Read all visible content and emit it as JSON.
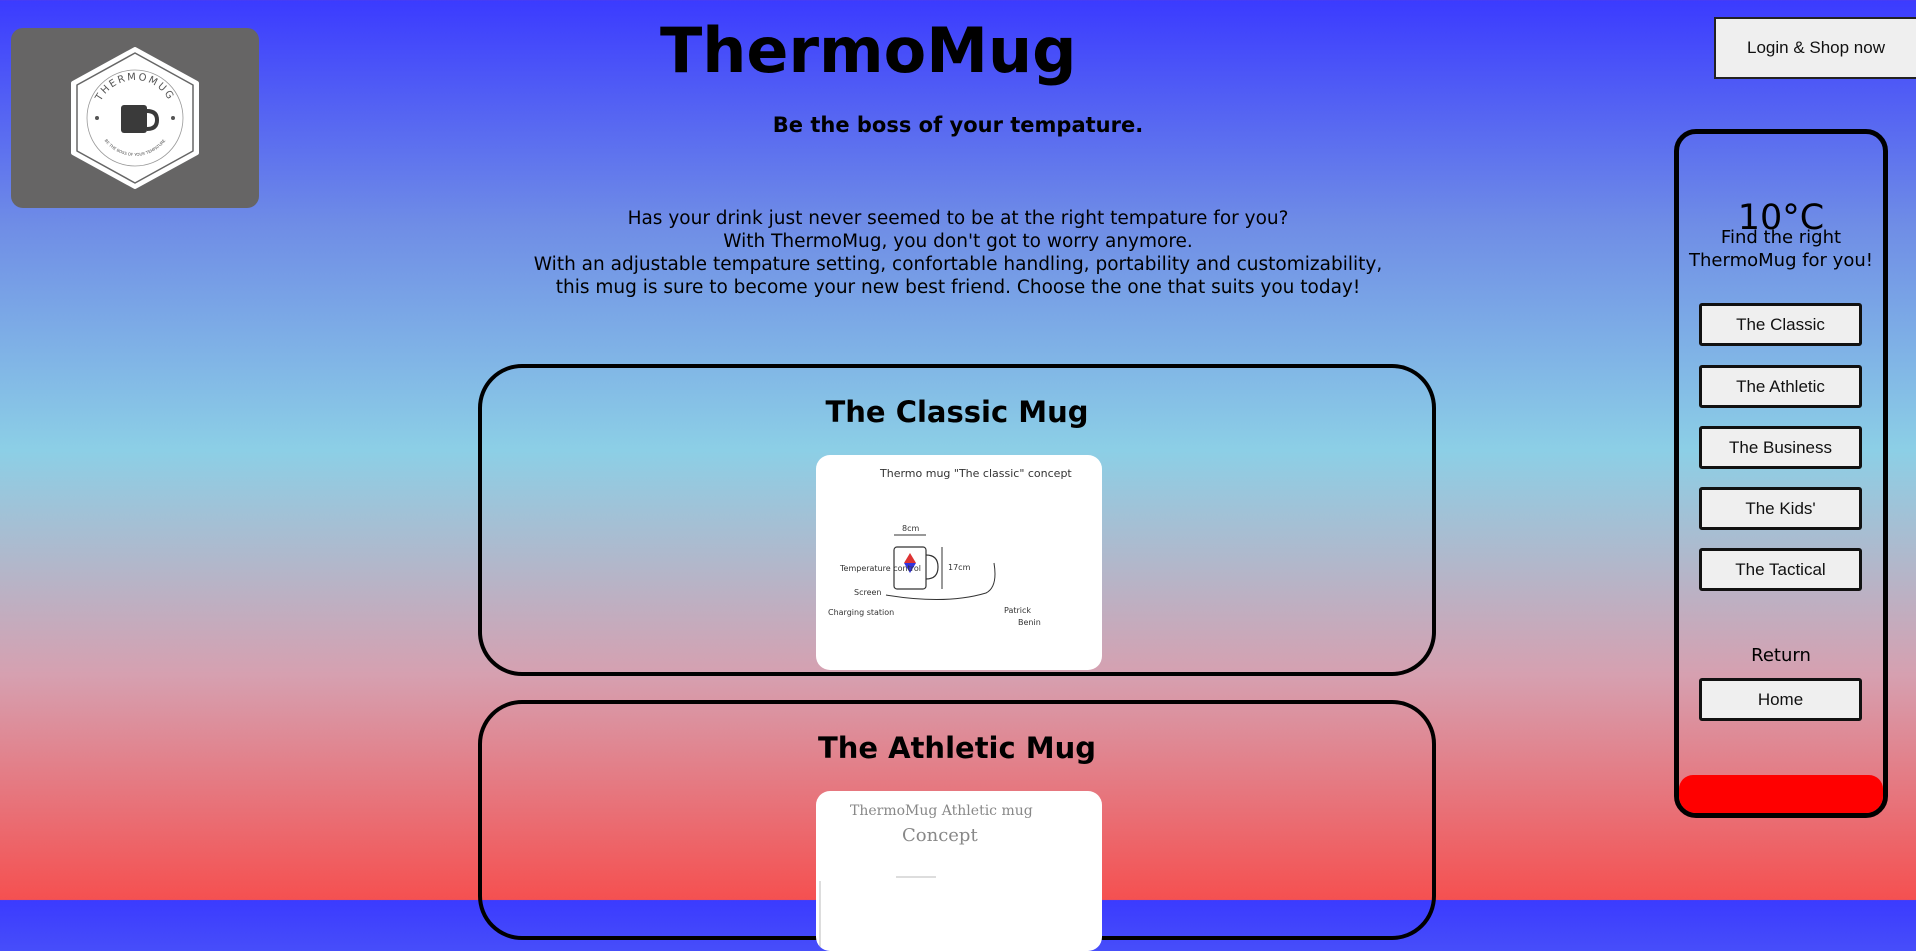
{
  "header": {
    "title": "ThermoMug",
    "tagline": "Be the boss of your tempature.",
    "login_button": "Login & Shop now"
  },
  "logo": {
    "ring_text": "THERMOMUG",
    "sub_text": "BE THE BOSS OF YOUR TEMPATURE",
    "icon": "mug-icon"
  },
  "intro": {
    "lines": [
      "Has your drink just never seemed to be at the right tempature for you?",
      "With ThermoMug, you don't got to worry anymore.",
      "With an adjustable tempature setting, confortable handling, portability and customizability,",
      "this mug is sure to become your new best friend. Choose the one that suits you today!"
    ]
  },
  "cards": [
    {
      "title": "The Classic Mug",
      "sketch": {
        "heading": "Thermo mug \"The classic\" concept",
        "notes": [
          "8cm",
          "17cm",
          "Temperature control",
          "Screen",
          "Charging station",
          "Patrick",
          "Benin"
        ]
      }
    },
    {
      "title": "The Athletic Mug",
      "sketch": {
        "heading": "ThermoMug Athletic mug",
        "subheading": "Concept"
      }
    }
  ],
  "sidebar": {
    "temperature": "10°C",
    "find_text_1": "Find the right",
    "find_text_2": "ThermoMug for you!",
    "buttons": [
      "The Classic",
      "The Athletic",
      "The Business",
      "The Kids'",
      "The Tactical"
    ],
    "return_label": "Return",
    "home_button": "Home",
    "heat_color": "#ff0000"
  }
}
